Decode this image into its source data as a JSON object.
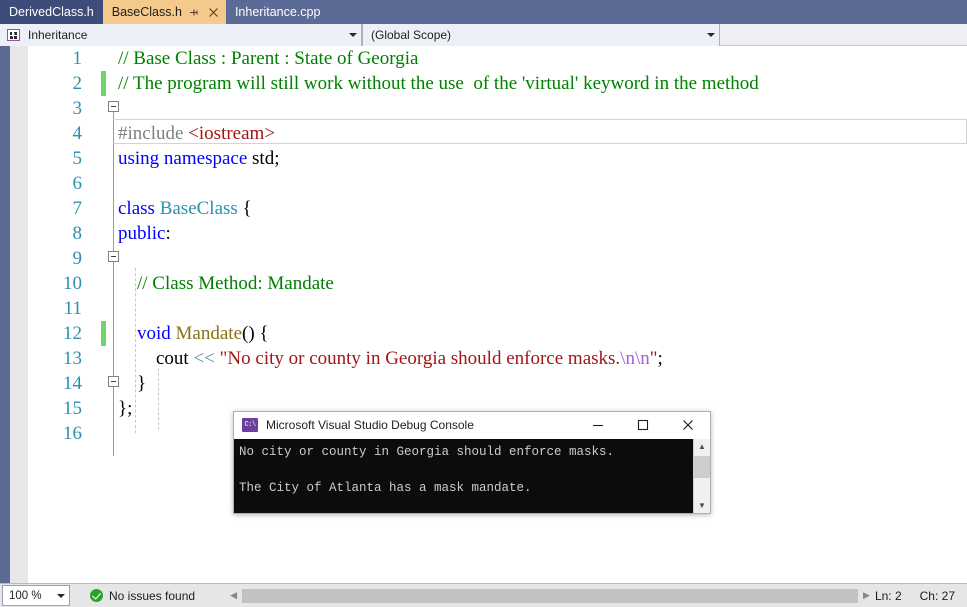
{
  "tabs": [
    {
      "label": "DerivedClass.h",
      "state": "inactive-dark"
    },
    {
      "label": "BaseClass.h",
      "state": "active",
      "pin_icon": "pin-icon",
      "close_icon": "close-icon"
    },
    {
      "label": "Inheritance.cpp",
      "state": "inactive-mid"
    }
  ],
  "navbar": {
    "project_icon": "project-icon",
    "project": "Inheritance",
    "scope": "(Global Scope)",
    "dropdown_icon": "chevron-down-icon"
  },
  "editor": {
    "lines": [
      {
        "n": "1",
        "segments": [
          {
            "t": "// Base Class : Parent : State of Georgia",
            "c": "c-comment"
          }
        ]
      },
      {
        "n": "2",
        "changed": true,
        "segments": [
          {
            "t": "// The program will still work without the use  of the 'virtual' keyword in the method",
            "c": "c-comment"
          }
        ]
      },
      {
        "n": "3",
        "segments": []
      },
      {
        "n": "4",
        "segments": [
          {
            "t": "#include ",
            "c": "c-pp"
          },
          {
            "t": "<iostream>",
            "c": "c-string"
          }
        ]
      },
      {
        "n": "5",
        "segments": [
          {
            "t": "using namespace ",
            "c": "c-keyword"
          },
          {
            "t": "std;",
            "c": "c-plain"
          }
        ]
      },
      {
        "n": "6",
        "segments": []
      },
      {
        "n": "7",
        "segments": [
          {
            "t": "class ",
            "c": "c-keyword"
          },
          {
            "t": "BaseClass ",
            "c": "c-type"
          },
          {
            "t": "{",
            "c": "c-plain"
          }
        ]
      },
      {
        "n": "8",
        "segments": [
          {
            "t": "public",
            "c": "c-keyword"
          },
          {
            "t": ":",
            "c": "c-plain"
          }
        ]
      },
      {
        "n": "9",
        "segments": []
      },
      {
        "n": "10",
        "segments": [
          {
            "t": "    // Class Method: Mandate",
            "c": "c-comment"
          }
        ]
      },
      {
        "n": "11",
        "segments": []
      },
      {
        "n": "12",
        "changed": true,
        "segments": [
          {
            "t": "    ",
            "c": "c-plain"
          },
          {
            "t": "void ",
            "c": "c-keyword"
          },
          {
            "t": "Mandate",
            "c": "c-func"
          },
          {
            "t": "() {",
            "c": "c-plain"
          }
        ]
      },
      {
        "n": "13",
        "segments": [
          {
            "t": "        cout ",
            "c": "c-plain"
          },
          {
            "t": "<< ",
            "c": "c-op"
          },
          {
            "t": "\"No city or county in Georgia should enforce masks.",
            "c": "c-string"
          },
          {
            "t": "\\n\\n",
            "c": "c-escape"
          },
          {
            "t": "\"",
            "c": "c-string"
          },
          {
            "t": ";",
            "c": "c-plain"
          }
        ]
      },
      {
        "n": "14",
        "segments": [
          {
            "t": "    }",
            "c": "c-plain"
          }
        ]
      },
      {
        "n": "15",
        "segments": [
          {
            "t": "};",
            "c": "c-plain"
          }
        ]
      },
      {
        "n": "16",
        "segments": []
      }
    ]
  },
  "console": {
    "icon": "console-app-icon",
    "icon_glyph": "C:\\",
    "title": "Microsoft Visual Studio Debug Console",
    "minimize_icon": "minimize-icon",
    "maximize_icon": "maximize-icon",
    "close_icon": "close-icon",
    "output": "No city or county in Georgia should enforce masks.\n\nThe City of Atlanta has a mask mandate.",
    "scroll_up_icon": "scroll-up-icon",
    "scroll_down_icon": "scroll-down-icon"
  },
  "statusbar": {
    "zoom": "100 %",
    "zoom_dropdown_icon": "chevron-down-icon",
    "issues_icon": "success-check-icon",
    "issues": "No issues found",
    "scroll_left_icon": "scroll-left-icon",
    "scroll_right_icon": "scroll-right-icon",
    "line": "Ln: 2",
    "column": "Ch: 27"
  }
}
